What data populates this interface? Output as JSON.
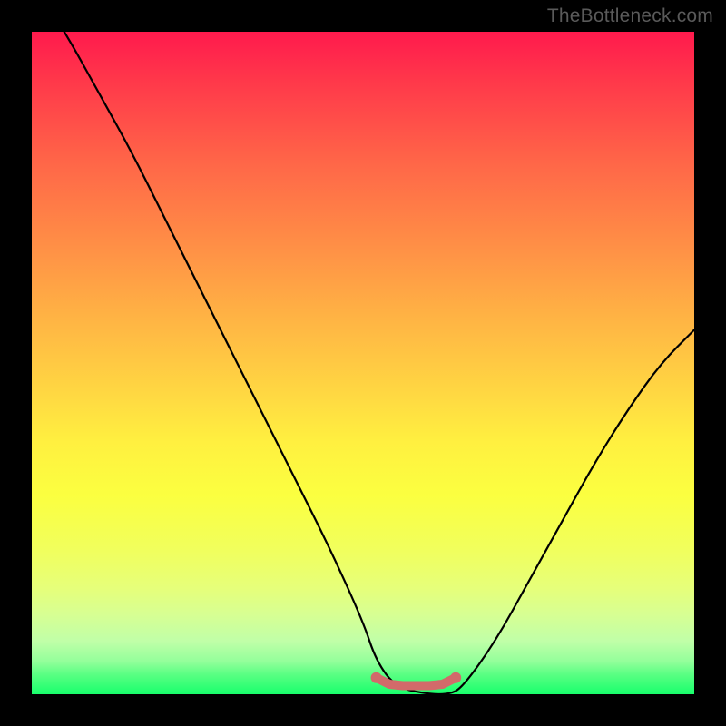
{
  "watermark": "TheBottleneck.com",
  "chart_data": {
    "type": "line",
    "title": "",
    "xlabel": "",
    "ylabel": "",
    "xlim": [
      0,
      100
    ],
    "ylim": [
      0,
      100
    ],
    "background_gradient": {
      "orientation": "vertical",
      "stops": [
        {
          "pos": 0,
          "color": "#ff1a4d"
        },
        {
          "pos": 20,
          "color": "#ff6748"
        },
        {
          "pos": 44,
          "color": "#ffb644"
        },
        {
          "pos": 62,
          "color": "#fff040"
        },
        {
          "pos": 84,
          "color": "#e6ff7a"
        },
        {
          "pos": 100,
          "color": "#18ff6c"
        }
      ]
    },
    "series": [
      {
        "name": "bottleneck-curve",
        "stroke": "#000000",
        "x": [
          0,
          5,
          10,
          15,
          20,
          25,
          30,
          35,
          40,
          45,
          50,
          52,
          55,
          60,
          63,
          65,
          70,
          75,
          80,
          85,
          90,
          95,
          100
        ],
        "y": [
          108,
          100,
          91,
          82,
          72,
          62,
          52,
          42,
          32,
          22,
          11,
          5,
          1,
          0,
          0,
          1,
          8,
          17,
          26,
          35,
          43,
          50,
          55
        ]
      },
      {
        "name": "optimal-range-marker",
        "stroke": "#d26a6a",
        "x": [
          52,
          54,
          56,
          58,
          60,
          62,
          64
        ],
        "y": [
          2.5,
          1.5,
          1.3,
          1.3,
          1.3,
          1.5,
          2.5
        ]
      }
    ],
    "annotations": []
  }
}
